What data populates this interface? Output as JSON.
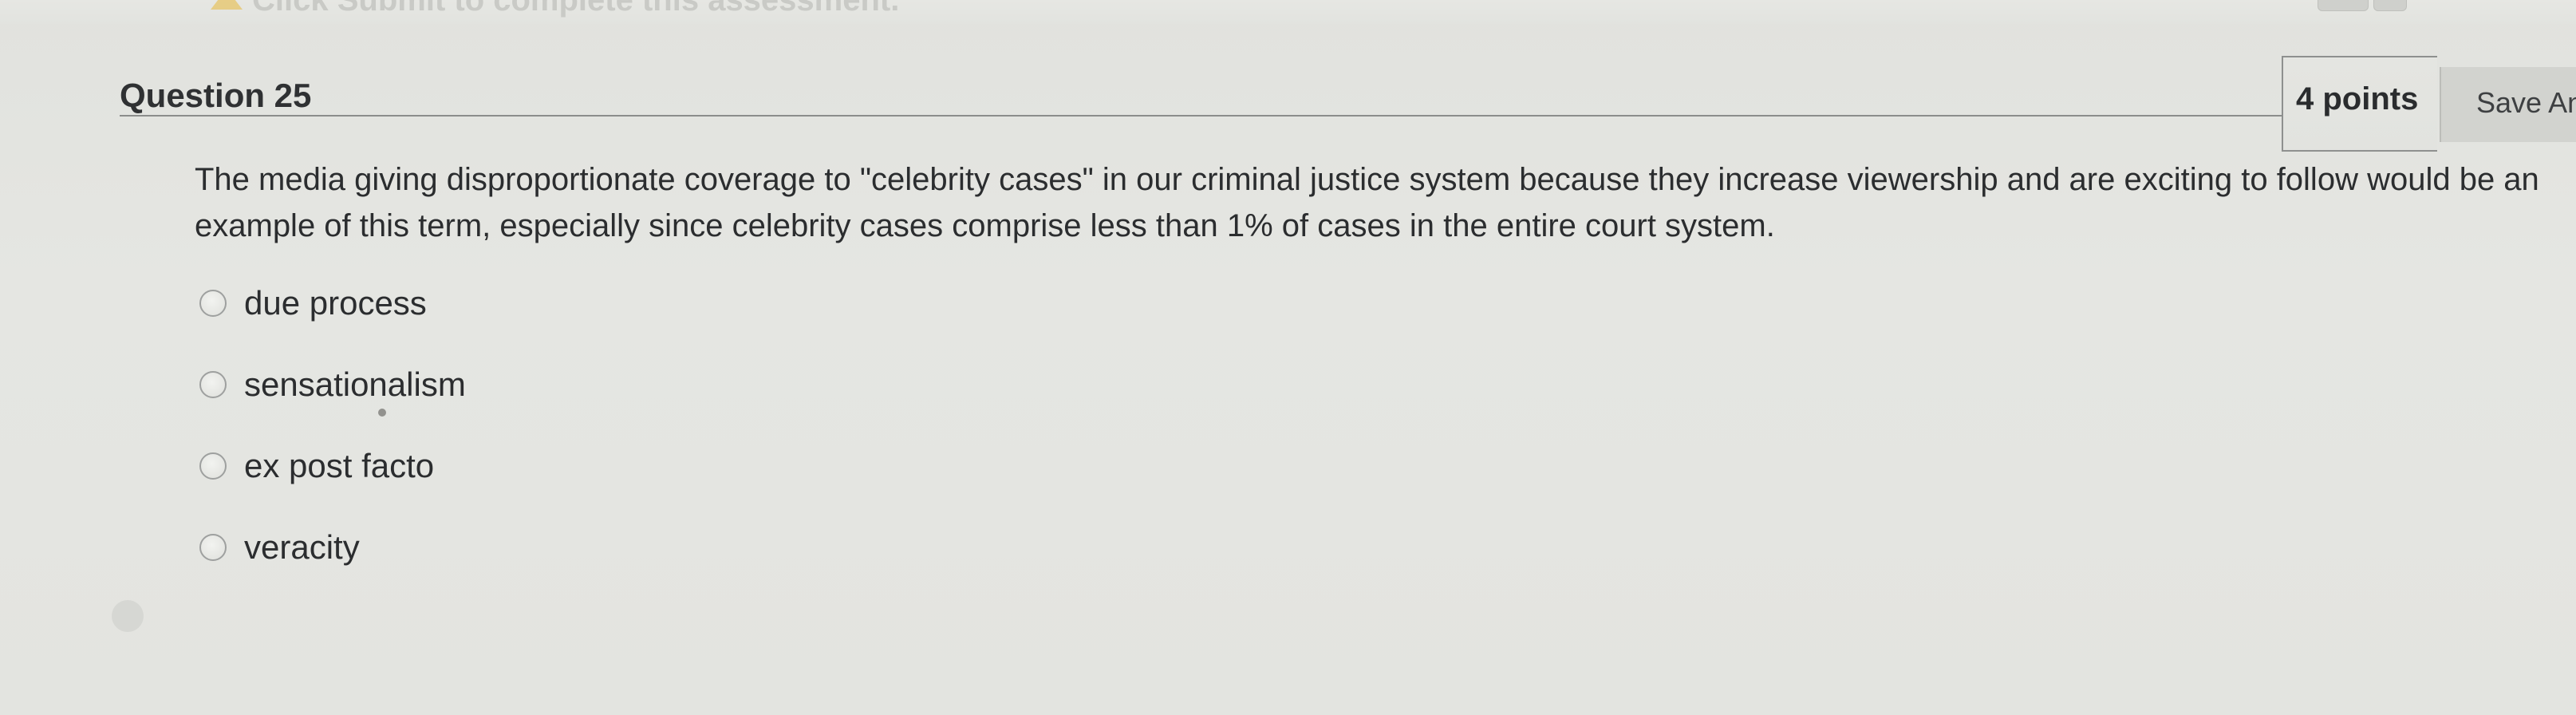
{
  "top_bar": {
    "warning_icon": "warning-triangle-icon",
    "instruction_text": "Click Submit to complete this assessment."
  },
  "question": {
    "title": "Question 25",
    "points": "4 points",
    "save_label": "Save Answer",
    "prompt": "The media giving disproportionate coverage to \"celebrity cases\" in our criminal justice system because they increase viewership and are exciting to follow would be an example of this term, especially since celebrity cases comprise less than 1% of cases in the entire court system.",
    "options": [
      {
        "label": "due process",
        "selected": false
      },
      {
        "label": "sensationalism",
        "selected": false
      },
      {
        "label": "ex post facto",
        "selected": false
      },
      {
        "label": "veracity",
        "selected": false
      }
    ]
  },
  "colors": {
    "background": "#e3e4e0",
    "text": "#2b2d2f",
    "rule": "#8b8d8c",
    "button": "#d2d3cf"
  }
}
